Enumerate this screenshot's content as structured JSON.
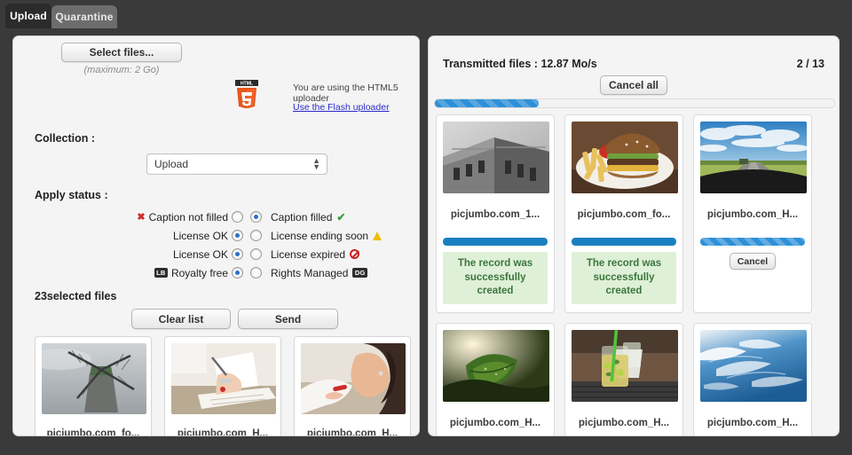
{
  "tabs": [
    {
      "label": "Upload",
      "active": true
    },
    {
      "label": "Quarantine",
      "active": false
    }
  ],
  "upload_panel": {
    "select_files_label": "Select files...",
    "maximum_note": "(maximum: 2 Go)",
    "html5_logo_text": "HTML",
    "html5_logo_number": "5",
    "uploader_note": "You are using the HTML5 uploader",
    "flash_link_label": "Use the Flash uploader",
    "collection_label": "Collection :",
    "collection_value": "Upload",
    "apply_status_label": "Apply status :",
    "status_rows": [
      {
        "left_label": "Caption not filled",
        "left_icon": "red-x-icon",
        "left_checked": false,
        "right_label": "Caption filled",
        "right_icon": "green-check-icon",
        "right_checked": true
      },
      {
        "left_label": "License OK",
        "left_icon": "",
        "left_checked": true,
        "right_label": "License ending soon",
        "right_icon": "yellow-warning-icon",
        "right_checked": false
      },
      {
        "left_label": "License OK",
        "left_icon": "",
        "left_checked": true,
        "right_label": "License expired",
        "right_icon": "red-prohibited-icon",
        "right_checked": false
      },
      {
        "left_label": "Royalty free",
        "left_icon": "lb-badge-icon",
        "left_badge": "LB",
        "left_checked": true,
        "right_label": "Rights Managed",
        "right_icon": "dg-badge-icon",
        "right_badge": "DG",
        "right_checked": false
      }
    ],
    "selected_files_label": "23selected files",
    "clear_list_label": "Clear list",
    "send_label": "Send",
    "files": [
      {
        "name": "picjumbo.com_fo..."
      },
      {
        "name": "picjumbo.com_H..."
      },
      {
        "name": "picjumbo.com_H..."
      }
    ]
  },
  "transmitted_panel": {
    "title": "Transmitted files : 12.87 Mo/s",
    "count": "2 / 13",
    "cancel_all_label": "Cancel all",
    "overall_progress_percent": 26,
    "cards": [
      {
        "name": "picjumbo.com_1...",
        "progress_percent": 100,
        "striped": false,
        "status_message": "The record was successfully created",
        "cancel_label": null
      },
      {
        "name": "picjumbo.com_fo...",
        "progress_percent": 100,
        "striped": false,
        "status_message": "The record was successfully created",
        "cancel_label": null
      },
      {
        "name": "picjumbo.com_H...",
        "progress_percent": 100,
        "striped": true,
        "status_message": null,
        "cancel_label": "Cancel"
      },
      {
        "name": "picjumbo.com_H...",
        "progress_percent": 0,
        "striped": false,
        "status_message": null,
        "cancel_label": null
      },
      {
        "name": "picjumbo.com_H...",
        "progress_percent": 0,
        "striped": false,
        "status_message": null,
        "cancel_label": null
      },
      {
        "name": "picjumbo.com_H...",
        "progress_percent": 0,
        "striped": false,
        "status_message": null,
        "cancel_label": null
      }
    ]
  },
  "colors": {
    "accent_blue": "#2d90d8",
    "progress_blue": "#1a7fc1",
    "success_bg": "#dff0d8",
    "success_text": "#3c763d",
    "window_bg": "#3a3a3a",
    "panel_bg": "#f4f4f4",
    "link": "#2b2bcc"
  }
}
